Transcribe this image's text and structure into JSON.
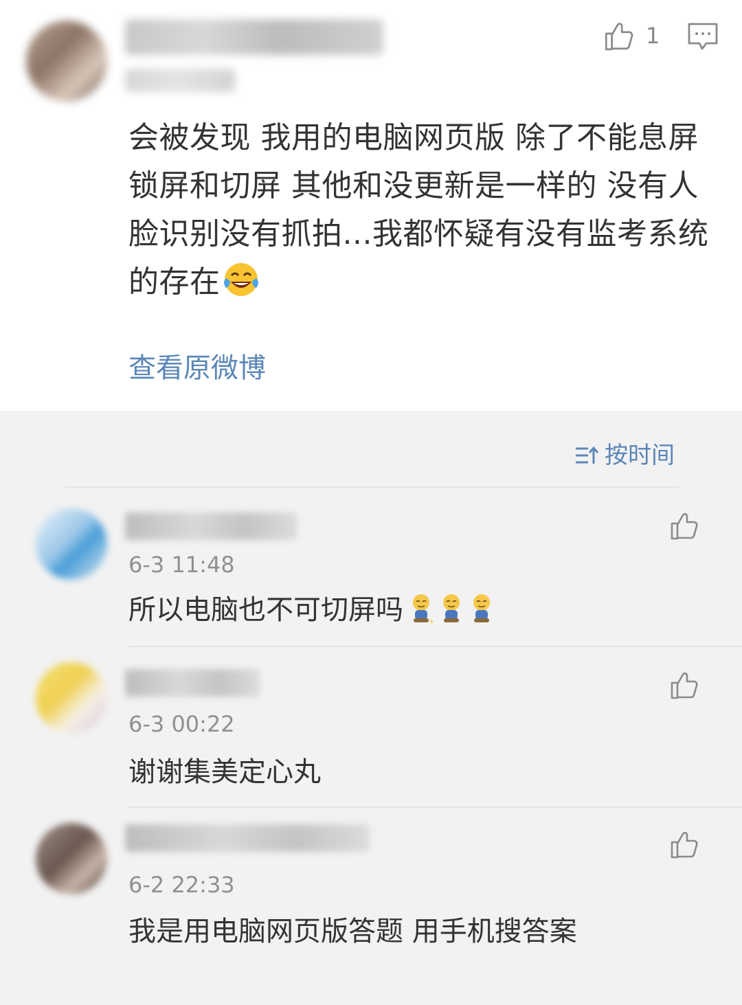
{
  "post": {
    "like_count": "1",
    "text": "会被发现 我用的电脑网页版 除了不能息屏锁屏和切屏 其他和没更新是一样的 没有人脸识别没有抓拍...我都怀疑有没有监考系统的存在",
    "emoji": "laughing-tears-emoji",
    "view_original_label": "查看原微博"
  },
  "sort": {
    "label": "按时间",
    "icon": "sort-icon"
  },
  "replies": [
    {
      "time": "6-3 11:48",
      "text": "所以电脑也不可切屏吗",
      "stickers": 3
    },
    {
      "time": "6-3 00:22",
      "text": "谢谢集美定心丸"
    },
    {
      "time": "6-2 22:33",
      "text": "我是用电脑网页版答题 用手机搜答案"
    }
  ],
  "colors": {
    "link": "#5b87b8",
    "text": "#333333",
    "muted": "#909090",
    "background": "#f2f2f2"
  }
}
